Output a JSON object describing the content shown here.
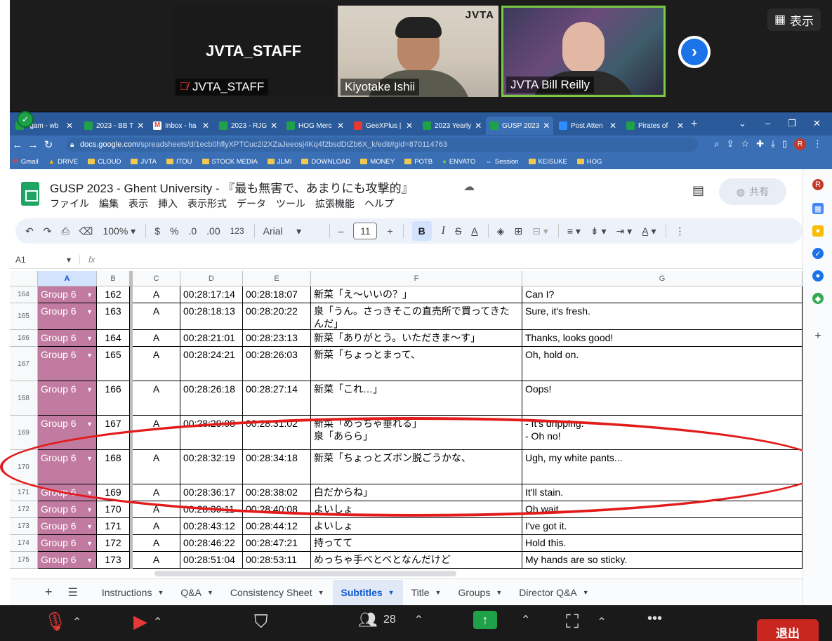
{
  "zoom": {
    "tiles": [
      {
        "big_label": "JVTA_STAFF",
        "name": "JVTA_STAFF",
        "muted": true
      },
      {
        "name": "Kiyotake Ishii",
        "logo": "JVTA"
      },
      {
        "name": "JVTA Bill Reilly"
      }
    ],
    "view_button": "表示",
    "bottom": {
      "participants": "28",
      "leave": "退出"
    }
  },
  "browser": {
    "tabs": [
      {
        "label": "-gam - wb",
        "color": "#1fa14a"
      },
      {
        "label": "2023 - BB T",
        "color": "#1fa14a"
      },
      {
        "label": "Inbox - ha",
        "color": "#ea4335"
      },
      {
        "label": "2023 - RJG",
        "color": "#1fa14a"
      },
      {
        "label": "HOG Merc",
        "color": "#1fa14a"
      },
      {
        "label": "GeeXPlus |",
        "color": "#e53935"
      },
      {
        "label": "2023 Yearly",
        "color": "#1fa14a"
      },
      {
        "label": "GUSP 2023",
        "color": "#1fa14a"
      },
      {
        "label": "Post Atten",
        "color": "#2d8cff"
      },
      {
        "label": "Pirates of",
        "color": "#1fa14a"
      }
    ],
    "url_main": "docs.google.com",
    "url_rest": "/spreadsheets/d/1ecb0hflyXPTCuc2i2XZaJeeosj4Kq4f2bsdDtZb6X_k/edit#gid=870114763",
    "bookmarks": [
      "Gmail",
      "DRIVE",
      "CLOUD",
      "JVTA",
      "ITOU",
      "STOCK MEDIA",
      "JLMI",
      "DOWNLOAD",
      "MONEY",
      "POTB",
      "ENVATO",
      "Session",
      "KEISUKE",
      "HOG"
    ]
  },
  "sheets": {
    "title": "GUSP 2023 - Ghent University - 『最も無害で、あまりにも攻撃的』",
    "menu": [
      "ファイル",
      "編集",
      "表示",
      "挿入",
      "表示形式",
      "データ",
      "ツール",
      "拡張機能",
      "ヘルプ"
    ],
    "share": "共有",
    "toolbar": {
      "zoom": "100%",
      "currency": "$",
      "percent": "%",
      "dec_less": ".0",
      "dec_more": ".00",
      "format_123": "123",
      "font": "Arial",
      "font_size": "11"
    },
    "cell_ref": "A1",
    "fx": "fx",
    "columns": [
      "A",
      "B",
      "C",
      "D",
      "E",
      "F",
      "G"
    ],
    "rows": [
      {
        "row": "164",
        "group": "Group 6",
        "b": "162",
        "c": "A",
        "d": "00:28:17:14",
        "e": "00:28:18:07",
        "f": "新菜「え〜いいの？」",
        "g": "Can I?"
      },
      {
        "row": "165",
        "group": "Group 6",
        "b": "163",
        "c": "A",
        "d": "00:28:18:13",
        "e": "00:28:20:22",
        "f": "泉「うん。さっきそこの直売所で買ってきたんだ」",
        "g": "Sure, it's fresh."
      },
      {
        "row": "166",
        "group": "Group 6",
        "b": "164",
        "c": "A",
        "d": "00:28:21:01",
        "e": "00:28:23:13",
        "f": "新菜「ありがとう。いただきま〜す」",
        "g": "Thanks, looks good!"
      },
      {
        "row": "167",
        "group": "Group 6",
        "b": "165",
        "c": "A",
        "d": "00:28:24:21",
        "e": "00:28:26:03",
        "f": "新菜「ちょっとまって、",
        "g": "Oh, hold on."
      },
      {
        "row": "168",
        "group": "Group 6",
        "b": "166",
        "c": "A",
        "d": "00:28:26:18",
        "e": "00:28:27:14",
        "f": "新菜「これ…」",
        "g": "Oops!"
      },
      {
        "row": "169",
        "group": "Group 6",
        "b": "167",
        "c": "A",
        "d": "00:28:29:08",
        "e": "00:28:31:02",
        "f": "新菜「めっちゃ垂れる」\n泉「あらら」",
        "g": "- It's dripping.\n- Oh no!"
      },
      {
        "row": "170",
        "group": "Group 6",
        "b": "168",
        "c": "A",
        "d": "00:28:32:19",
        "e": "00:28:34:18",
        "f": "新菜「ちょっとズボン脱ごうかな、",
        "g": "Ugh, my white pants..."
      },
      {
        "row": "171",
        "group": "Group 6",
        "b": "169",
        "c": "A",
        "d": "00:28:36:17",
        "e": "00:28:38:02",
        "f": "白だからね」",
        "g": "It'll stain."
      },
      {
        "row": "172",
        "group": "Group 6",
        "b": "170",
        "c": "A",
        "d": "00:28:39:11",
        "e": "00:28:40:08",
        "f": "よいしょ",
        "g": "Oh wait."
      },
      {
        "row": "173",
        "group": "Group 6",
        "b": "171",
        "c": "A",
        "d": "00:28:43:12",
        "e": "00:28:44:12",
        "f": "よいしょ",
        "g": "I've got it."
      },
      {
        "row": "174",
        "group": "Group 6",
        "b": "172",
        "c": "A",
        "d": "00:28:46:22",
        "e": "00:28:47:21",
        "f": "持ってて",
        "g": "Hold this."
      },
      {
        "row": "175",
        "group": "Group 6",
        "b": "173",
        "c": "A",
        "d": "00:28:51:04",
        "e": "00:28:53:11",
        "f": "めっちゃ手べとべとなんだけど",
        "g": "My hands are so sticky."
      }
    ],
    "sheet_tabs": [
      {
        "label": "Instructions",
        "active": false
      },
      {
        "label": "Q&A",
        "active": false
      },
      {
        "label": "Consistency Sheet",
        "active": false
      },
      {
        "label": "Subtitles",
        "active": true
      },
      {
        "label": "Title",
        "active": false
      },
      {
        "label": "Groups",
        "active": false
      },
      {
        "label": "Director Q&A",
        "active": false
      }
    ]
  },
  "colors": {
    "group_cell": "#c27ba0",
    "annotation": "#e21b1b",
    "zoom_speaker_border": "#7ac943"
  }
}
